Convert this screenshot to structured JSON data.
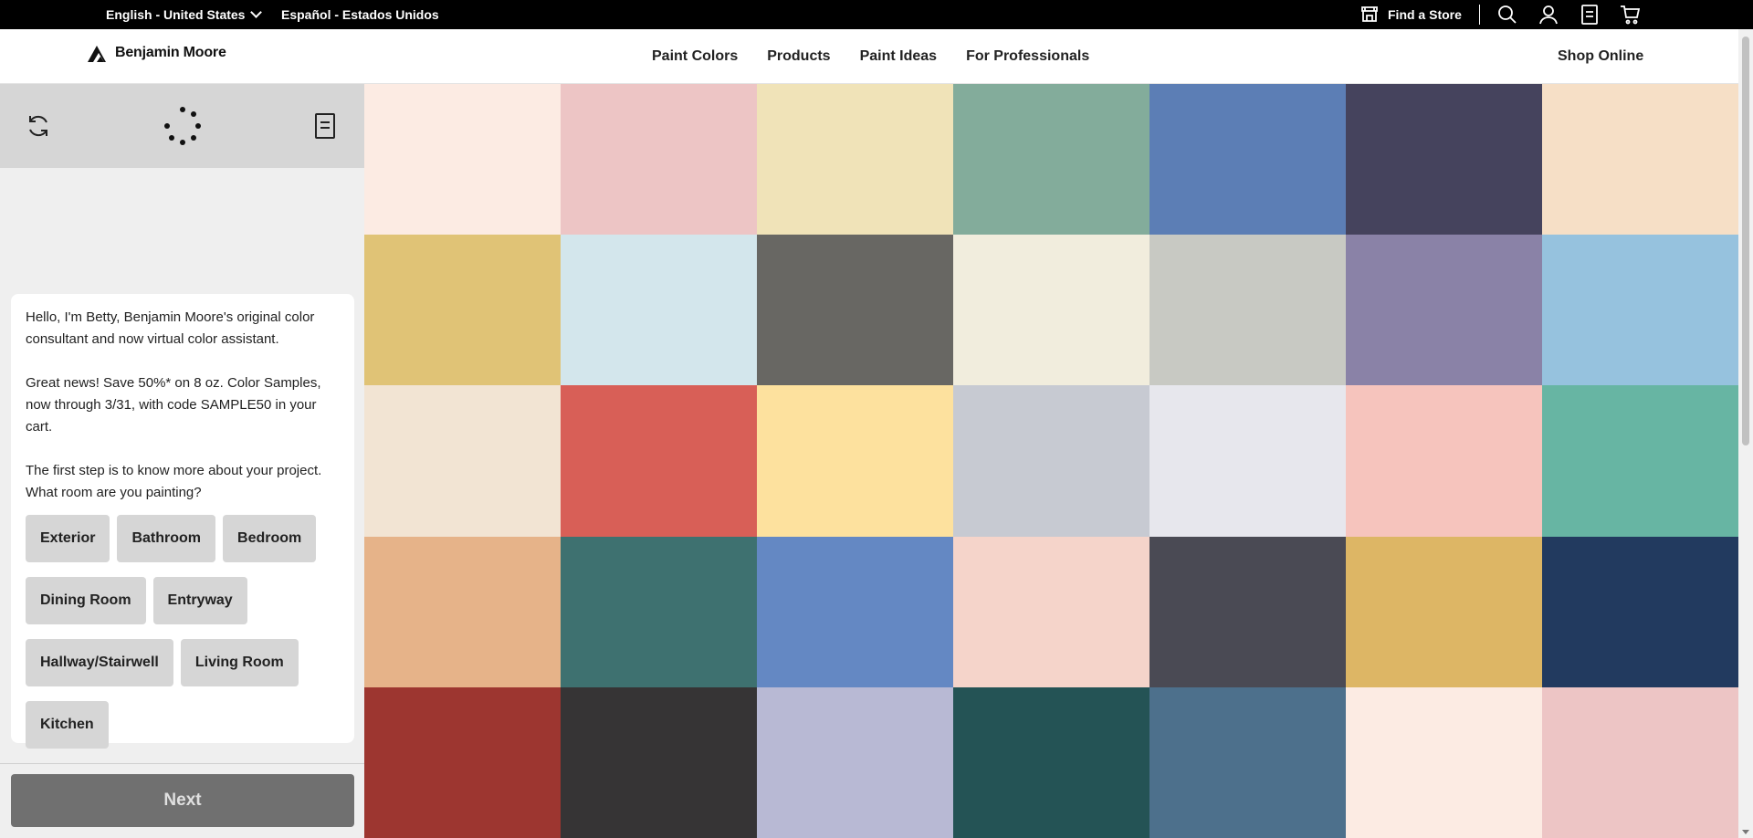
{
  "topbar": {
    "lang_current": "English - United States",
    "lang_alt": "Español - Estados Unidos",
    "find_store": "Find a Store"
  },
  "nav": {
    "brand": "Benjamin Moore",
    "links": [
      "Paint Colors",
      "Products",
      "Paint Ideas",
      "For Professionals"
    ],
    "shop": "Shop Online"
  },
  "assistant": {
    "messages": [
      "Hello, I'm Betty, Benjamin Moore's original color consultant and now virtual color assistant.",
      "Great news! Save 50%* on 8 oz. Color Samples, now through 3/31, with code SAMPLE50 in your cart.",
      "The first step is to know more about your project. What room are you painting?"
    ],
    "rooms": [
      "Exterior",
      "Bathroom",
      "Bedroom",
      "Dining Room",
      "Entryway",
      "Hallway/Stairwell",
      "Living Room",
      "Kitchen"
    ],
    "next_label": "Next"
  },
  "swatches": [
    "#fcebe3",
    "#edc5c5",
    "#f0e3b8",
    "#83ac9b",
    "#5c7eb5",
    "#45435d",
    "#f6dfc6",
    "#e0c376",
    "#d3e6ec",
    "#686763",
    "#f1eddd",
    "#c8c9c3",
    "#8a82a7",
    "#96c2de",
    "#f2e4d3",
    "#d85f57",
    "#fde19e",
    "#c7cad2",
    "#e7e7ed",
    "#f6c4bd",
    "#67b5a3",
    "#e6b389",
    "#3e7170",
    "#6488c3",
    "#f5d4ca",
    "#4a4a54",
    "#ddb665",
    "#223a5f",
    "#9d3630",
    "#363435",
    "#b8b9d4",
    "#245355",
    "#4d708c",
    "#fcebe3",
    "#edc5c5"
  ]
}
